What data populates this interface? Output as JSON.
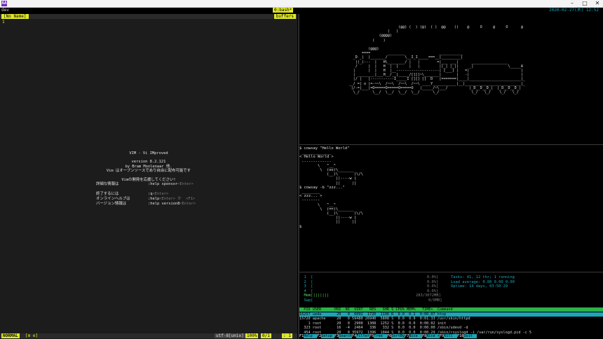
{
  "window": {
    "icon_label": "AA",
    "min": "–",
    "max": "□",
    "close": "✕"
  },
  "tmux": {
    "session": "dev",
    "pane_label": "0:bash*",
    "datetime": "2020-02-27(木) 12:52"
  },
  "vim": {
    "tab_active": "[No Name]",
    "tab_right": "buffers",
    "line_number": "1",
    "splash": {
      "title": "VIM - Vi IMproved",
      "version": "version 8.2.121",
      "author": "by Bram Moolenaar 他.",
      "open_source": "Vim はオープンソースであり自由に配布可能です",
      "uganda_line": "Vimの開発を応援してください!",
      "rows": [
        {
          "label": "詳細な情報は",
          "cmd": ":help sponsor",
          "key": "<Enter>"
        },
        {
          "label": "終了するには",
          "cmd": ":q",
          "key": "<Enter>"
        },
        {
          "label": "オンラインヘルプは",
          "cmd": ":help",
          "key": "<Enter>",
          "extra": "か  <F1>"
        },
        {
          "label": "バージョン情報は",
          "cmd": ":help version8",
          "key": "<Enter>"
        }
      ]
    },
    "status": {
      "mode": "NORMAL",
      "branch": "[m e]",
      "encoding": "utf-8[unix]",
      "percent": "100%",
      "position": "0/1",
      "col": ":  1"
    }
  },
  "sl": {
    "lines": [
      "                                              (@@) (  ) (@)  ( )  @@    ()    @     O     @     O      @",
      "                                         (   )",
      "                                     (@@@@)",
      "                                  (    )",
      "",
      "                                (@@@)",
      "                             ====        ________                ___________",
      "                         _D _|  |_______/        \\__I_I_____===__|_________|",
      "                          |(_)---  |   H\\________/ |   |        =|___ ___|      _________________",
      "                          /     |  |   H  |  |     |   |         ||_| |_||     _|                \\_____A",
      "                         |      |  |   H  |__--------------------| [___] |   =|                        |",
      "                         | ________|___H__/__|_____/[][]~\\_______|       |   -|                        |",
      "                         |/ |   |-----------I_____I [][] []  D   |=======|____|________________________|_",
      "                       __/ =| o |=-~~\\  /~~\\  /~~\\  /~~\\ ____Y___________|__|__________________________|_",
      "                        |/-=|___|=O=====O=====O=====O   |_____/~\\___/          |_D__D__D_|  |_D__D__D_|",
      "                         \\_/      \\__/  \\__/  \\__/  \\__/      \\_/               \\_/   \\_/    \\_/   \\_/"
    ]
  },
  "cow": {
    "lines": [
      "$ cowsay \"Hello World\"",
      " _____________",
      "< Hello World >",
      " -------------",
      "        \\   ^__^",
      "         \\  (oo)\\_______",
      "            (__)\\       )\\/\\",
      "                ||----w |",
      "                ||     ||",
      "$ cowsay -b \"zzz...\"",
      " ________",
      "< zzz... >",
      " --------",
      "        \\   ^__^",
      "         \\  (==)\\_______",
      "            (__)\\       )\\/\\",
      "                ||----w |",
      "                ||     ||",
      "$"
    ]
  },
  "htop": {
    "cpus": [
      {
        "label": "  1  [",
        "value": "0.0%]"
      },
      {
        "label": "  2  [",
        "value": "0.0%]"
      },
      {
        "label": "  3  [",
        "value": "0.0%]"
      },
      {
        "label": "  4  [",
        "value": "0.0%]"
      }
    ],
    "mem": {
      "label": "  Mem[|||||||",
      "value": "283/3072MB]"
    },
    "swp": {
      "label": "  Swp[",
      "value": "0/0MB]"
    },
    "tasks": "Tasks: 41, 12 thr; 1 running",
    "load": "Load average: 0.00 0.00 0.00",
    "uptime": "Uptime: 14 days, 03:50:29",
    "header": "  PID USER      PRI  NI  VIRT   RES   SHR S CPU% MEM%   TIME+  Command",
    "selected": "16257 ueda       20   0  6092  1720  1196 R  0.0  0.1  0:00.07 htop",
    "rows": [
      "15720 apache     20   0 59480 26940  5808 S  0.0  0.9  0:01.33 /usr/sbin/httpd",
      "    1 root       20   0  2900  1308  1252 S  0.0  0.0  0:00.02 init",
      "  323 root       16  -4  2464   336   332 S  0.0  0.0  0:00.00 /sbin/udevd -d",
      "  454 root       20   0 35972  1396  1044 S  0.0  0.0  0:00.29 /sbin/rsyslogd -i /var/run/syslogd.pid -c 5",
      "  455 root       20   0 35972  1396  1044 S  0.0  0.0  0:00.31 /sbin/rsyslogd -i /var/run/syslogd.pid -c 5"
    ],
    "fkeys": [
      {
        "k": "F1",
        "l": "Help"
      },
      {
        "k": "F2",
        "l": "Setup"
      },
      {
        "k": "F3",
        "l": "Search"
      },
      {
        "k": "F4",
        "l": "Filter"
      },
      {
        "k": "F5",
        "l": "Tree"
      },
      {
        "k": "F6",
        "l": "SortBy"
      },
      {
        "k": "F7",
        "l": "Nice -"
      },
      {
        "k": "F8",
        "l": "Nice +"
      },
      {
        "k": "F9",
        "l": "Kill"
      },
      {
        "k": "F10",
        "l": "Quit"
      }
    ]
  }
}
